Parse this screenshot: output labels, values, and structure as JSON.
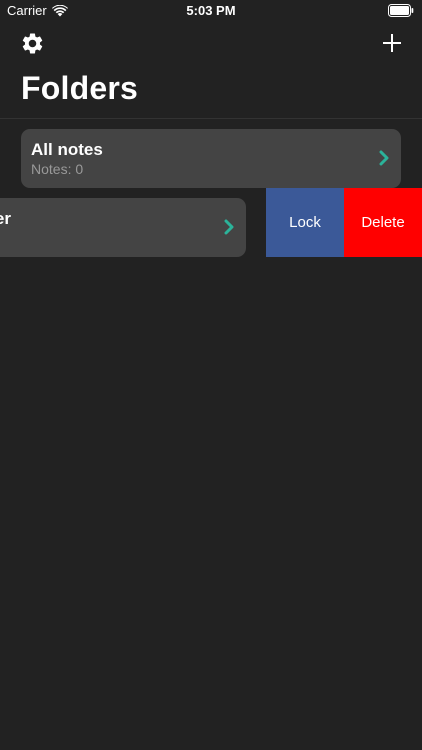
{
  "status_bar": {
    "carrier": "Carrier",
    "time": "5:03 PM",
    "wifi_icon": "wifi-icon",
    "battery_icon": "battery-icon"
  },
  "nav": {
    "title": "Folders",
    "settings_icon": "gear-icon",
    "add_icon": "plus-icon"
  },
  "folders": [
    {
      "title": "All notes",
      "subtitle": "Notes: 0"
    },
    {
      "title_visible_fragment": "er"
    }
  ],
  "swipe_actions": {
    "lock_label": "Lock",
    "delete_label": "Delete"
  },
  "colors": {
    "background": "#222222",
    "card": "#444444",
    "accent_chevron": "#2bb39a",
    "lock": "#3b5998",
    "delete": "#ff0000",
    "subtitle": "#999999"
  }
}
